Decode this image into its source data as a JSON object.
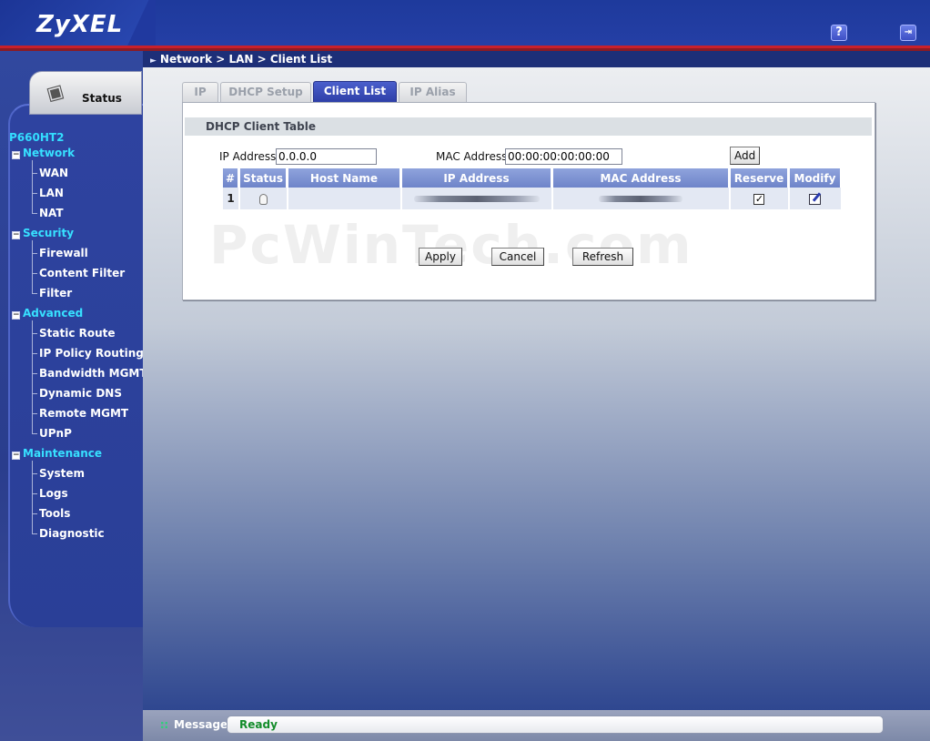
{
  "header": {
    "brand": "ZyXEL",
    "help_symbol": "?",
    "logout_symbol": "⇥"
  },
  "breadcrumb": "Network > LAN > Client List",
  "sidebar": {
    "status_tab": "Status",
    "device_model": "P660HT2",
    "categories": [
      {
        "label": "Network",
        "toggle": "−",
        "items": [
          "WAN",
          "LAN",
          "NAT"
        ]
      },
      {
        "label": "Security",
        "toggle": "−",
        "items": [
          "Firewall",
          "Content Filter",
          "Filter"
        ]
      },
      {
        "label": "Advanced",
        "toggle": "−",
        "items": [
          "Static Route",
          "IP Policy Routing",
          "Bandwidth MGMT",
          "Dynamic DNS",
          "Remote MGMT",
          "UPnP"
        ]
      },
      {
        "label": "Maintenance",
        "toggle": "−",
        "items": [
          "System",
          "Logs",
          "Tools",
          "Diagnostic"
        ]
      }
    ]
  },
  "tabs": [
    {
      "label": "IP",
      "active": false
    },
    {
      "label": "DHCP Setup",
      "active": false
    },
    {
      "label": "Client List",
      "active": true
    },
    {
      "label": "IP Alias",
      "active": false
    }
  ],
  "panel": {
    "title": "DHCP Client Table",
    "ip_label": "IP Address",
    "ip_value": "0.0.0.0",
    "mac_label": "MAC Address",
    "mac_value": "00:00:00:00:00:00",
    "add_label": "Add"
  },
  "table": {
    "headers": [
      "#",
      "Status",
      "Host Name",
      "IP Address",
      "MAC Address",
      "Reserve",
      "Modify"
    ],
    "rows": [
      {
        "index": "1",
        "status_icon": "bulb-icon",
        "host_name": "",
        "reserve_checked": true,
        "modify_icon": "edit-icon"
      }
    ]
  },
  "buttons": {
    "apply": "Apply",
    "cancel": "Cancel",
    "refresh": "Refresh"
  },
  "watermark": "PcWinTech.com",
  "message_bar": {
    "label": "Message",
    "value": "Ready"
  }
}
